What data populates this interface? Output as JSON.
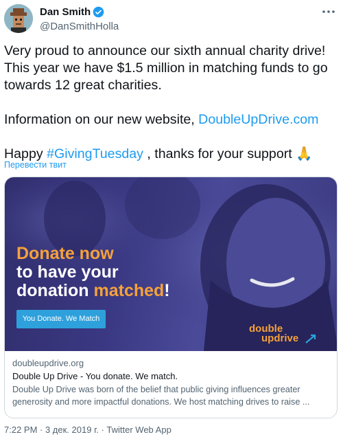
{
  "user": {
    "display_name": "Dan Smith",
    "handle": "@DanSmithHolla"
  },
  "tweet": {
    "line1": "Very proud to announce our sixth annual charity drive!",
    "line2": "This year we have $1.5 million in matching funds to go",
    "line3": "towards 12 great charities.",
    "info_prefix": "Information on our new website, ",
    "info_link": "DoubleUpDrive.com",
    "happy_prefix": "Happy ",
    "hashtag": "#GivingTuesday",
    "happy_suffix": " , thanks for your support ",
    "emoji": "🙏",
    "translate": "Перевести твит"
  },
  "card": {
    "headline_line1": "Donate now",
    "headline_line2": "to have your",
    "headline_line3a": "donation ",
    "headline_line3b": "matched",
    "headline_line3c": "!",
    "cta_label": "You Donate. We Match",
    "logo_line1": "double",
    "logo_line2": "updrive",
    "domain": "doubleupdrive.org",
    "title": "Double Up Drive - You donate. We match.",
    "description_line1": "Double Up Drive was born of the belief that public giving influences greater",
    "description_line2": "generosity and more impactful donations. We host matching drives to raise ..."
  },
  "meta": {
    "text": "7:22 PM · 3 дек. 2019 г. · Twitter Web App"
  },
  "colors": {
    "link": "#1d9bf0",
    "accent_orange": "#f6a13a",
    "cta_blue": "#2ea1dc",
    "banner_purple": "#3a3882"
  }
}
